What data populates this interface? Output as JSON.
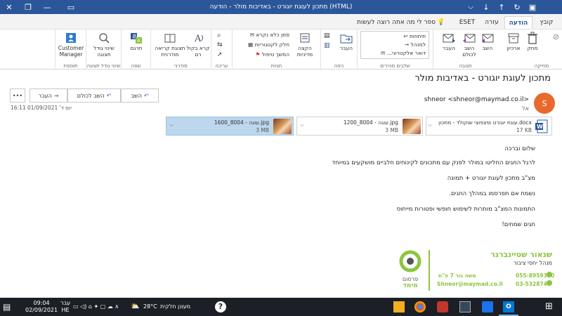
{
  "window": {
    "title": "מתכון לעוגת יוגורט - באדיבות מולר - הודעה (HTML)"
  },
  "menu": {
    "tabs": [
      "קובץ",
      "הודעה",
      "עזרה",
      "ESET"
    ],
    "tell_me": "ספר לי מה אתה רוצה לעשות"
  },
  "ribbon": {
    "groups": {
      "delete": "מחיקה",
      "respond": "תגובה",
      "quicksteps": "שלבים מהירים",
      "move": "הזזה",
      "tags": "תגיות",
      "editing": "עריכה",
      "speech": "מודרני",
      "language": "שפה",
      "zoom": "שינוי גודל תצוגה",
      "addin": "תוספת"
    },
    "buttons": {
      "ignore": "התעלם",
      "delete": "מחק",
      "archive": "ארכיון",
      "reply": "השב",
      "reply_all": "השב לכולם",
      "forward": "העבר",
      "move": "העבר",
      "policy": "הקצה מדיניות",
      "mark_unread": "סמן כלא נקרא",
      "categorize": "חלק לקטגוריות",
      "followup": "המשך טיפול",
      "read_aloud": "קרא בקול רם",
      "immersive": "תצוגת קריאה מודרנית",
      "translate": "תרגם",
      "zoom": "שינוי גודל תצוגה",
      "customer_manager": "Customer Manager"
    },
    "quicksteps": [
      "תיחוזות",
      "למנהל",
      "דואר אלקטרוני..."
    ]
  },
  "message": {
    "subject": "מתכון לעוגת יוגורט - באדיבות מולר",
    "sender": "shneor <shneor@maymad.co.il>",
    "avatar_letter": "S",
    "to_label": "אל",
    "date": "יום ד' 01/09/2021 16:11",
    "actions": {
      "reply": "השב",
      "reply_all": "השב לכולם",
      "forward": "העבר"
    },
    "attachments": [
      {
        "name": "עוגת יוגורט ופצפוצי שוקולד - מתכון.docx",
        "size": "17 KB",
        "type": "word"
      },
      {
        "name": "עוגה - 8004_1200.jpg",
        "size": "3 MB",
        "type": "image"
      },
      {
        "name": "עוגה - 8004_1600.jpg",
        "size": "3 MB",
        "type": "image"
      }
    ],
    "body": [
      "שלום וברכה",
      "לרגל החגים החליטו במולר לפנק עם מתכונים לקינוחים חלביים מושקעים במיוחד",
      "מצ\"ב מתכון לעוגת יוגורט + תמונה",
      "נשמח אם תפרסמו במהלך החגים.",
      "התמונות המצ\"ב מותרות לשימוש חופשי ופטורות מייחוס",
      "חגים שמחים!"
    ],
    "signature": {
      "name": "שנאור שטיינברגר",
      "role": "מנהל יחסי ציבור",
      "phone1": "055-8959390",
      "phone2": "03-5328747",
      "address": "משה גור 7 פ\"ת",
      "email": "Shneor@maymad.co.il",
      "logo_line1": "פרסום",
      "logo_line2": "מימד"
    }
  },
  "taskbar": {
    "time": "09:04",
    "date": "02/09/2021",
    "lang1": "עבר",
    "lang2": "HE",
    "temp": "28°C",
    "weather": "מעונן חלקית"
  },
  "colors": {
    "titlebar": "#2b579a",
    "accent": "#2b579a",
    "avatar": "#e8692e",
    "signature_green": "#8cc63f",
    "taskbar": "#1c1f26"
  }
}
